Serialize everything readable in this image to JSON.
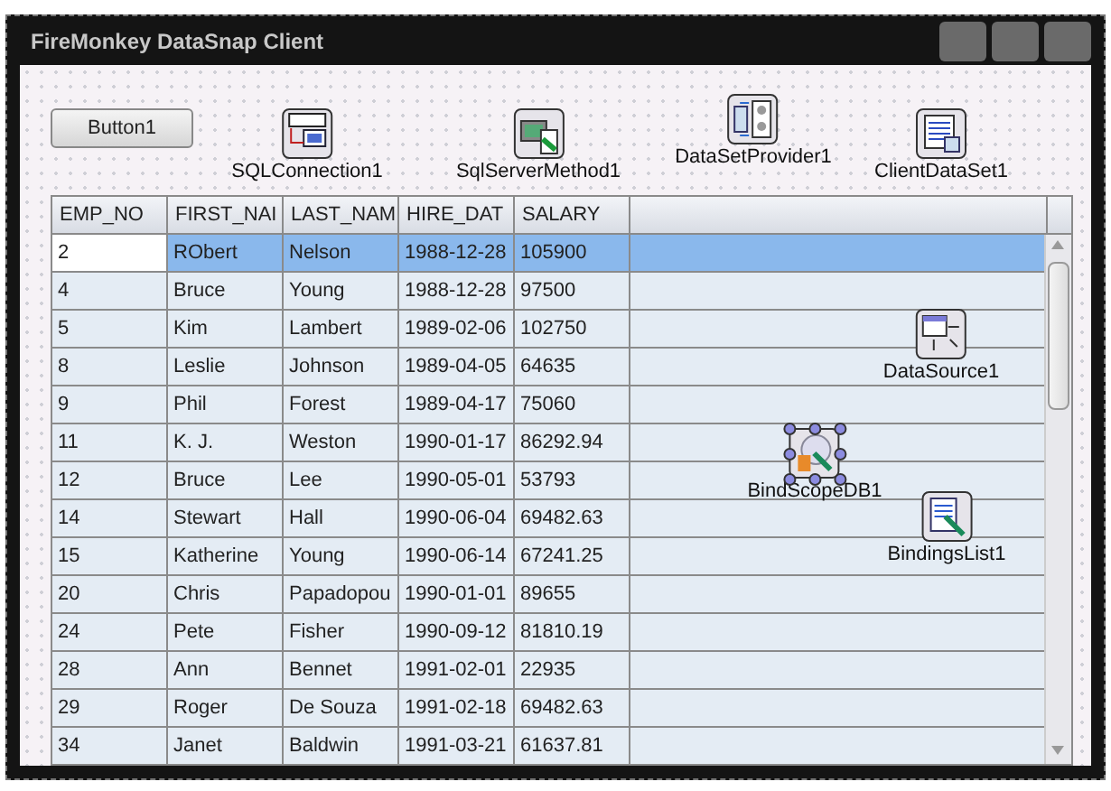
{
  "window": {
    "title": "FireMonkey DataSnap Client"
  },
  "button": {
    "label": "Button1"
  },
  "grid": {
    "columns": [
      "EMP_NO",
      "FIRST_NAI",
      "LAST_NAM",
      "HIRE_DAT",
      "SALARY"
    ],
    "rows": [
      {
        "cells": [
          "2",
          "RObert",
          "Nelson",
          "1988-12-28",
          "105900"
        ],
        "selected": true
      },
      {
        "cells": [
          "4",
          "Bruce",
          "Young",
          "1988-12-28",
          "97500"
        ],
        "selected": false
      },
      {
        "cells": [
          "5",
          "Kim",
          "Lambert",
          "1989-02-06",
          "102750"
        ],
        "selected": false
      },
      {
        "cells": [
          "8",
          "Leslie",
          "Johnson",
          "1989-04-05",
          "64635"
        ],
        "selected": false
      },
      {
        "cells": [
          "9",
          "Phil",
          "Forest",
          "1989-04-17",
          "75060"
        ],
        "selected": false
      },
      {
        "cells": [
          "11",
          "K. J.",
          "Weston",
          "1990-01-17",
          "86292.94"
        ],
        "selected": false
      },
      {
        "cells": [
          "12",
          "Bruce",
          "Lee",
          "1990-05-01",
          "53793"
        ],
        "selected": false
      },
      {
        "cells": [
          "14",
          "Stewart",
          "Hall",
          "1990-06-04",
          "69482.63"
        ],
        "selected": false
      },
      {
        "cells": [
          "15",
          "Katherine",
          "Young",
          "1990-06-14",
          "67241.25"
        ],
        "selected": false
      },
      {
        "cells": [
          "20",
          "Chris",
          "Papadopou",
          "1990-01-01",
          "89655"
        ],
        "selected": false
      },
      {
        "cells": [
          "24",
          "Pete",
          "Fisher",
          "1990-09-12",
          "81810.19"
        ],
        "selected": false
      },
      {
        "cells": [
          "28",
          "Ann",
          "Bennet",
          "1991-02-01",
          "22935"
        ],
        "selected": false
      },
      {
        "cells": [
          "29",
          "Roger",
          "De Souza",
          "1991-02-18",
          "69482.63"
        ],
        "selected": false
      },
      {
        "cells": [
          "34",
          "Janet",
          "Baldwin",
          "1991-03-21",
          "61637.81"
        ],
        "selected": false
      }
    ]
  },
  "components": [
    {
      "name": "SQLConnection1",
      "kind": "connection",
      "selected": false
    },
    {
      "name": "SqlServerMethod1",
      "kind": "method",
      "selected": false
    },
    {
      "name": "DataSetProvider1",
      "kind": "provider",
      "selected": false
    },
    {
      "name": "ClientDataSet1",
      "kind": "dataset",
      "selected": false
    },
    {
      "name": "DataSource1",
      "kind": "datasource",
      "selected": false
    },
    {
      "name": "BindScopeDB1",
      "kind": "bindscope",
      "selected": true
    },
    {
      "name": "BindingsList1",
      "kind": "bindings",
      "selected": false
    }
  ]
}
